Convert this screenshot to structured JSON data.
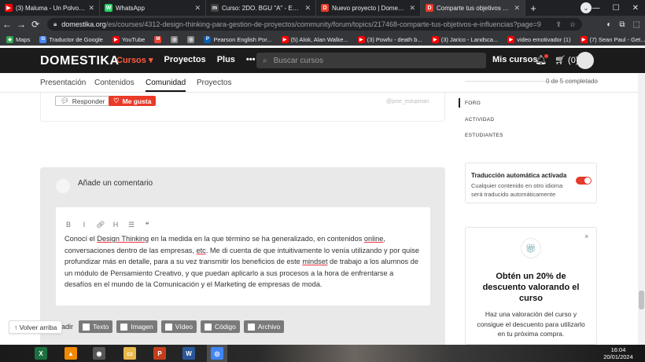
{
  "browser": {
    "tabs": [
      {
        "title": "(3) Maluma - Un Polvo (Au...",
        "color": "#ff0000",
        "glyph": "▶"
      },
      {
        "title": "WhatsApp",
        "color": "#25d366",
        "glyph": "W"
      },
      {
        "title": "Curso: 2DO. BGU \"A\" - EMPRE...",
        "color": "#444444",
        "glyph": "m"
      },
      {
        "title": "Nuevo proyecto | Domestika",
        "color": "#ea3a28",
        "glyph": "D"
      },
      {
        "title": "Comparte tus objetivos e influ...",
        "color": "#ea3a28",
        "glyph": "D"
      }
    ],
    "new_tab": "+",
    "tab_search": "⌄",
    "window_controls": [
      "—",
      "☐",
      "✕"
    ],
    "nav": {
      "back": "←",
      "forward": "→",
      "reload": "⟳"
    },
    "url_host": "domestika.org",
    "url_path": "/es/courses/4312-design-thinking-para-gestion-de-proyectos/community/forum/topics/217468-comparte-tus-objetivos-e-influencias?page=9",
    "omni_icons": [
      "⇪",
      "☆"
    ],
    "ext_icons": [
      "◐",
      "⧉",
      "⬚"
    ],
    "bookmarks": [
      {
        "label": "Maps",
        "color": "#34a853",
        "glyph": "◆"
      },
      {
        "label": "Traductor de Google",
        "color": "#4285f4",
        "glyph": "G"
      },
      {
        "label": "YouTube",
        "color": "#ff0000",
        "glyph": "▶"
      },
      {
        "label": "",
        "color": "#ea4335",
        "glyph": "M"
      },
      {
        "label": "",
        "color": "#888888",
        "glyph": "◎"
      },
      {
        "label": "",
        "color": "#888888",
        "glyph": "◎"
      },
      {
        "label": "Pearson English Por...",
        "color": "#0a5eb0",
        "glyph": "P"
      },
      {
        "label": "(5) Alok, Alan Walke...",
        "color": "#ff0000",
        "glyph": "▶"
      },
      {
        "label": "(3) Powfu - death b...",
        "color": "#ff0000",
        "glyph": "▶"
      },
      {
        "label": "(3) Jarico - Landsca...",
        "color": "#ff0000",
        "glyph": "▶"
      },
      {
        "label": "video emotivador (1)",
        "color": "#ff0000",
        "glyph": "▶"
      },
      {
        "label": "(7) Sean Paul - Get...",
        "color": "#ff0000",
        "glyph": "▶"
      }
    ]
  },
  "site": {
    "logo": "DOMESTIKA",
    "nav": [
      "Cursos ▾",
      "Proyectos",
      "Plus",
      "•••"
    ],
    "search_icon": "⌕",
    "search_placeholder": "Buscar cursos",
    "my_courses": "Mis cursos",
    "bell_icon": "🔔︎",
    "cart_icon": "🛒︎",
    "cart_count": "0"
  },
  "subnav": {
    "items": [
      "Presentación",
      "Contenidos",
      "Comunidad",
      "Proyectos"
    ],
    "active": "Comunidad",
    "progress_text": "0 de 5 completado"
  },
  "previous_comment": {
    "reply_label": "Responder",
    "like_label": "Me gusta",
    "author": "@jose_estupinan"
  },
  "comment": {
    "title": "Añade un comentario",
    "toolbar": [
      "B",
      "I",
      "🔗︎",
      "H",
      "☰",
      "❝"
    ],
    "text_parts": [
      {
        "t": "Conocí el ",
        "sp": false
      },
      {
        "t": "Design Thinking",
        "sp": true
      },
      {
        "t": " en la medida en la que término se ha generalizado, en contenidos ",
        "sp": false
      },
      {
        "t": "online",
        "sp": true
      },
      {
        "t": ", conversaciones dentro de las empresas, ",
        "sp": false
      },
      {
        "t": "etc",
        "sp": true
      },
      {
        "t": ". Me di cuenta de que intuitivamente lo venía utilizando y por quise profundizar más en detalle, para a su vez transmitir los beneficios de este ",
        "sp": false
      },
      {
        "t": "mindset",
        "sp": true
      },
      {
        "t": " de trabajo a los alumnos de un módulo de Pensamiento Creativo, y que puedan aplicarlo a sus procesos a la hora de enfrentarse a desafíos en el mundo de la Comunicación y el Marketing de empresas de moda.",
        "sp": false
      }
    ],
    "attach_label": "adir",
    "attach_buttons": [
      "Texto",
      "Imagen",
      "Vídeo",
      "Código",
      "Archivo"
    ],
    "attach_icons": [
      "text-icon",
      "image-icon",
      "video-icon",
      "code-icon",
      "file-icon"
    ]
  },
  "back_to_top": "↑ Volver arriba",
  "sidebar": {
    "nav": [
      "FORO",
      "ACTIVIDAD",
      "ESTUDIANTES"
    ],
    "translation_title": "Traducción automática activada",
    "translation_desc": "Cualquier contenido en otro idioma será traducido automáticamente",
    "translation_on": true,
    "promo_close": "×",
    "promo_icon": "🎁︎",
    "promo_title": "Obtén un 20% de descuento valorando el curso",
    "promo_desc": "Haz una valoración del curso y consigue el descuento para utilizarlo en tu próxima compra."
  },
  "taskbar": {
    "apps": [
      {
        "name": "excel-icon",
        "glyph": "X",
        "color": "#1d6f42"
      },
      {
        "name": "vlc-icon",
        "glyph": "▲",
        "color": "#f08a00"
      },
      {
        "name": "media-icon",
        "glyph": "◉",
        "color": "#555555"
      },
      {
        "name": "folder-icon",
        "glyph": "▭",
        "color": "#e8b84a"
      },
      {
        "name": "powerpoint-icon",
        "glyph": "P",
        "color": "#c43e1c"
      },
      {
        "name": "word-icon",
        "glyph": "W",
        "color": "#2b579a"
      },
      {
        "name": "chrome-icon",
        "glyph": "◎",
        "color": "#4285f4"
      }
    ],
    "time": "16:04",
    "date": "20/01/2024"
  },
  "colors": {
    "accent": "#ea3a28",
    "header_bg": "#1b1b1b"
  }
}
